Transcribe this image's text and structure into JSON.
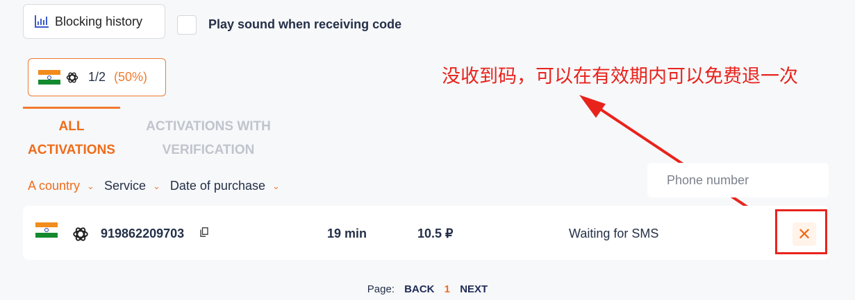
{
  "header": {
    "history_button_label": "Blocking history",
    "sound_label": "Play sound when receiving code"
  },
  "country_chip": {
    "flag": "india-flag",
    "service_icon": "openai-icon",
    "ratio": "1/2",
    "percent": "(50%)"
  },
  "tabs": {
    "all": "ALL ACTIVATIONS",
    "verification": "ACTIVATIONS WITH VERIFICATION",
    "active": "all"
  },
  "annotation": {
    "text": "没收到码，可以在有效期内可以免费退一次",
    "color": "#e8231c"
  },
  "filters": [
    {
      "label": "A country",
      "active": true
    },
    {
      "label": "Service",
      "active": false
    },
    {
      "label": "Date of purchase",
      "active": false
    }
  ],
  "search": {
    "placeholder": "Phone number"
  },
  "rows": [
    {
      "flag": "india-flag",
      "service_icon": "openai-icon",
      "number": "919862209703",
      "time": "19 min",
      "price": "10.5 ₽",
      "status": "Waiting for SMS",
      "cancel": "✕"
    }
  ],
  "pager": {
    "label": "Page:",
    "back": "BACK",
    "current": "1",
    "next": "NEXT"
  },
  "colors": {
    "accent": "#ef6c1a",
    "annotation": "#e8231c",
    "nav": "#1e2a55"
  }
}
